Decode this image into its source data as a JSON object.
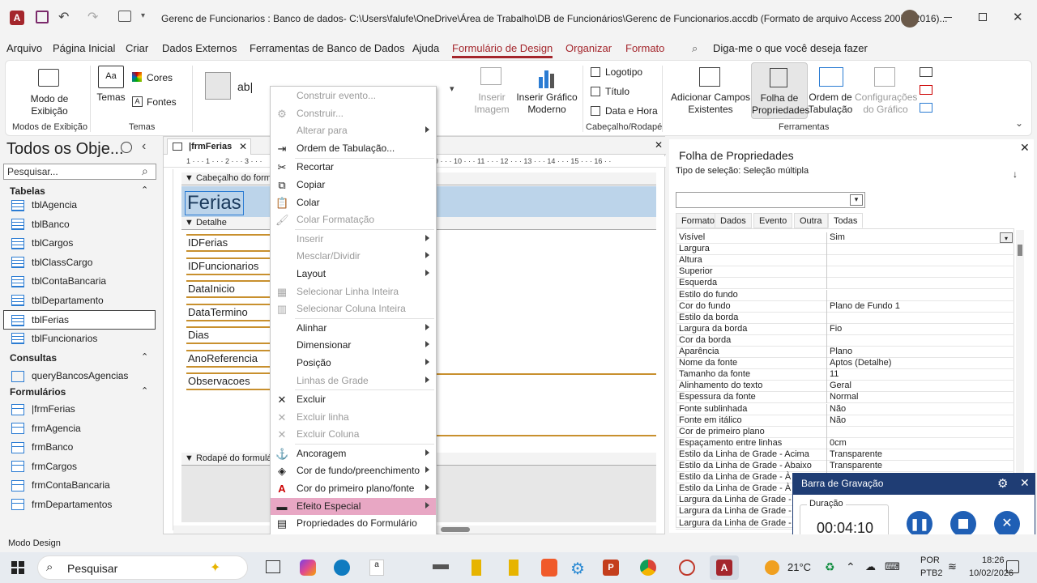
{
  "titlebar": {
    "title": "Gerenc de Funcionarios : Banco de dados- C:\\Users\\falufe\\OneDrive\\Área de Trabalho\\DB de Funcionários\\Gerenc de Funcionarios.accdb (Formato de arquivo Access 2007 - 2016)...",
    "app_icon": "access-icon"
  },
  "menubar": [
    "Arquivo",
    "Página Inicial",
    "Criar",
    "Dados Externos",
    "Ferramentas de Banco de Dados",
    "Ajuda",
    "Formulário de Design",
    "Organizar",
    "Formato"
  ],
  "tellme": "Diga-me o que você deseja fazer",
  "ribbon": {
    "modo_exibicao": [
      "Modo de",
      "Exibição"
    ],
    "temas": "Temas",
    "cores": "Cores",
    "fontes": "Fontes",
    "inserir_imagem": [
      "Inserir",
      "Imagem"
    ],
    "inserir_grafico": [
      "Inserir Gráfico",
      "Moderno"
    ],
    "logotipo": "Logotipo",
    "titulo": "Título",
    "data_hora": "Data e Hora",
    "adicionar_campos": [
      "Adicionar Campos",
      "Existentes"
    ],
    "folha_propriedades": [
      "Folha de",
      "Propriedades"
    ],
    "ordem_tabulacao": [
      "Ordem de",
      "Tabulação"
    ],
    "config_grafico": [
      "Configurações",
      "do Gráfico"
    ],
    "groups": {
      "modos": "Modos de Exibição",
      "temas": "Temas",
      "cabecalho": "Cabeçalho/Rodapé",
      "ferramentas": "Ferramentas"
    }
  },
  "nav": {
    "title": "Todos os Obje...",
    "search_placeholder": "Pesquisar...",
    "sections": {
      "tabelas": "Tabelas",
      "consultas": "Consultas",
      "formularios": "Formulários"
    },
    "tables": [
      "tblAgencia",
      "tblBanco",
      "tblCargos",
      "tblClassCargo",
      "tblContaBancaria",
      "tblDepartamento",
      "tblFerias",
      "tblFuncionarios"
    ],
    "queries": [
      "queryBancosAgencias"
    ],
    "forms": [
      "|frmFerias",
      "frmAgencia",
      "frmBanco",
      "frmCargos",
      "frmContaBancaria",
      "frmDepartamentos"
    ]
  },
  "designer": {
    "tab": "|frmFerias",
    "header_section": "Cabeçalho do formu",
    "detail_section": "Detalhe",
    "footer_section": "Rodapé do formulá",
    "form_title": "Ferias",
    "fields": [
      "IDFerias",
      "IDFuncionarios",
      "DataInicio",
      "DataTermino",
      "Dias",
      "AnoReferencia",
      "Observacoes"
    ],
    "ruler": "1 · · · 1 · · · 2 · · · 3 · · ·",
    "ruler_right": "9 · · · 10 · · · 11 · · · 12 · · · 13 · · · 14 · · · 15 · · · 16 · ·"
  },
  "context_menu": [
    {
      "label": "Construir evento...",
      "disabled": true,
      "icon": ""
    },
    {
      "label": "Construir...",
      "disabled": true,
      "icon": "build-icon"
    },
    {
      "label": "Alterar para",
      "disabled": true,
      "submenu": true
    },
    {
      "label": "Ordem de Tabulação...",
      "disabled": false,
      "icon": "tab-order-icon"
    },
    {
      "label": "Recortar",
      "disabled": false,
      "icon": "scissors-icon"
    },
    {
      "label": "Copiar",
      "disabled": false,
      "icon": "copy-icon"
    },
    {
      "label": "Colar",
      "disabled": false,
      "icon": "paste-icon"
    },
    {
      "label": "Colar Formatação",
      "disabled": true,
      "icon": "paste-format-icon"
    },
    {
      "label": "Inserir",
      "disabled": true,
      "submenu": true
    },
    {
      "label": "Mesclar/Dividir",
      "disabled": true,
      "submenu": true
    },
    {
      "label": "Layout",
      "disabled": false,
      "submenu": true
    },
    {
      "label": "Selecionar Linha Inteira",
      "disabled": true,
      "icon": "select-row-icon"
    },
    {
      "label": "Selecionar Coluna Inteira",
      "disabled": true,
      "icon": "select-column-icon"
    },
    {
      "label": "Alinhar",
      "disabled": false,
      "submenu": true
    },
    {
      "label": "Dimensionar",
      "disabled": false,
      "submenu": true
    },
    {
      "label": "Posição",
      "disabled": false,
      "submenu": true
    },
    {
      "label": "Linhas de Grade",
      "disabled": true,
      "submenu": true
    },
    {
      "label": "Excluir",
      "disabled": false,
      "icon": "delete-icon"
    },
    {
      "label": "Excluir linha",
      "disabled": true,
      "icon": "delete-row-icon"
    },
    {
      "label": "Excluir Coluna",
      "disabled": true,
      "icon": "delete-column-icon"
    },
    {
      "label": "Ancoragem",
      "disabled": false,
      "submenu": true,
      "icon": "anchor-icon"
    },
    {
      "label": "Cor de fundo/preenchimento",
      "disabled": false,
      "submenu": true,
      "icon": "fill-color-icon"
    },
    {
      "label": "Cor do primeiro plano/fonte",
      "disabled": false,
      "submenu": true,
      "icon": "font-color-icon"
    },
    {
      "label": "Efeito Especial",
      "disabled": false,
      "submenu": true,
      "highlighted": true,
      "icon": "special-effect-icon"
    },
    {
      "label": "Propriedades do Formulário",
      "disabled": false,
      "icon": "form-properties-icon"
    },
    {
      "label": "Propriedades",
      "disabled": false,
      "icon": "properties-icon"
    }
  ],
  "props": {
    "title": "Folha de Propriedades",
    "selection_type_label": "Tipo de seleção:",
    "selection_type_value": "Seleção múltipla",
    "tabs": [
      "Formato",
      "Dados",
      "Evento",
      "Outra",
      "Todas"
    ],
    "rows": [
      [
        "Visível",
        "Sim"
      ],
      [
        "Largura",
        ""
      ],
      [
        "Altura",
        ""
      ],
      [
        "Superior",
        ""
      ],
      [
        "Esquerda",
        ""
      ],
      [
        "Estilo do fundo",
        ""
      ],
      [
        "Cor do fundo",
        "Plano de Fundo 1"
      ],
      [
        "Estilo da borda",
        ""
      ],
      [
        "Largura da borda",
        "Fio"
      ],
      [
        "Cor da borda",
        ""
      ],
      [
        "Aparência",
        "Plano"
      ],
      [
        "Nome da fonte",
        "Aptos (Detalhe)"
      ],
      [
        "Tamanho da fonte",
        "11"
      ],
      [
        "Alinhamento do texto",
        "Geral"
      ],
      [
        "Espessura da fonte",
        "Normal"
      ],
      [
        "Fonte sublinhada",
        "Não"
      ],
      [
        "Fonte em itálico",
        "Não"
      ],
      [
        "Cor de primeiro plano",
        ""
      ],
      [
        "Espaçamento entre linhas",
        "0cm"
      ],
      [
        "Estilo da Linha de Grade - Acima",
        "Transparente"
      ],
      [
        "Estilo da Linha de Grade - Abaixo",
        "Transparente"
      ],
      [
        "Estilo da Linha de Grade - À E",
        ""
      ],
      [
        "Estilo da Linha de Grade - À D",
        ""
      ],
      [
        "Largura da Linha de Grade - Aci",
        ""
      ],
      [
        "Largura da Linha de Grade - A",
        ""
      ],
      [
        "Largura da Linha de Grade - À",
        ""
      ]
    ]
  },
  "recording": {
    "title": "Barra de Gravação",
    "duration_label": "Duração",
    "duration": "00:04:10"
  },
  "status": "Modo Design",
  "taskbar": {
    "search": "Pesquisar",
    "weather": "21°C",
    "lang1": "POR",
    "lang2": "PTB2",
    "time": "18:26",
    "date": "10/02/2026"
  },
  "colors": {
    "accent": "#a4262c",
    "field_border": "#c8902e",
    "highlight": "#e8a7c4",
    "recording_bg": "#1f3d74"
  }
}
